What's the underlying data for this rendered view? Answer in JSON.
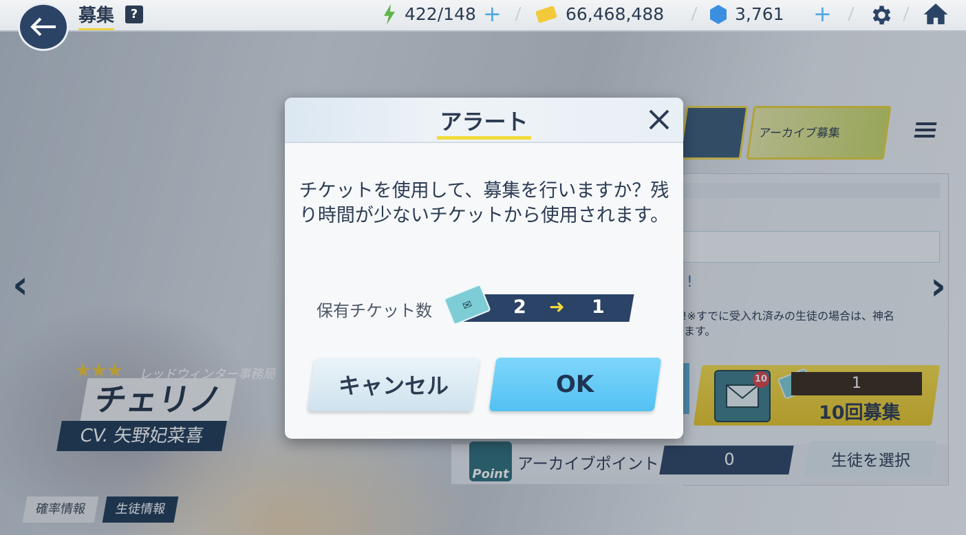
{
  "header": {
    "title": "募集",
    "help_label": "?",
    "ap_value": "422/148",
    "credits_value": "66,468,488",
    "gems_value": "3,761",
    "add_label": "+"
  },
  "banners": {
    "archive_label": "アーカイブ募集"
  },
  "panel": {
    "title_fragment": "!",
    "notice_line1": "!※すでに受入れ済みの生徒の場合は、神名",
    "notice_line2": "ます。",
    "ten_pull_count": "1",
    "ten_pull_label": "10回募集",
    "mail_badge": "10",
    "archive_point_label": "アーカイブポイント",
    "archive_point_value": "0",
    "select_student_label": "生徒を選択",
    "point_icon_label": "Point"
  },
  "character": {
    "stars": "★★★",
    "school": "レッドウィンター事務局",
    "name": "チェリノ",
    "cv": "CV. 矢野妃菜喜"
  },
  "bottom_tabs": [
    "確率情報",
    "生徒情報"
  ],
  "nav": {
    "prev": "‹",
    "next": "›"
  },
  "dialog": {
    "title": "アラート",
    "message": "チケットを使用して、募集を行いますか？残り時間が少ないチケットから使用されます。",
    "ticket_count_label": "保有チケット数",
    "ticket_from": "2",
    "ticket_arrow": "➜",
    "ticket_to": "1",
    "cancel_label": "キャンセル",
    "ok_label": "OK"
  },
  "colors": {
    "navy": "#2b3b52",
    "accent_yellow": "#f2dc3a",
    "ok_blue": "#52c1f2"
  }
}
